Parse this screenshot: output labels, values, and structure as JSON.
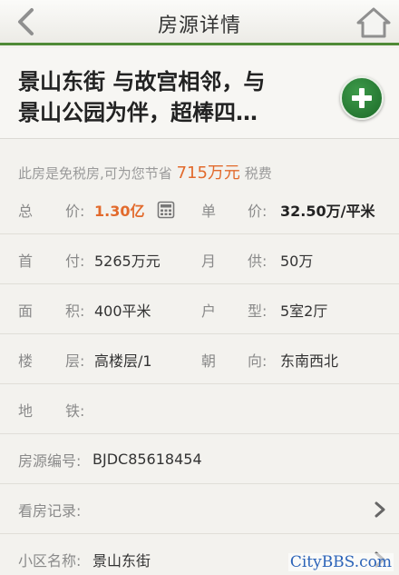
{
  "navbar": {
    "title": "房源详情"
  },
  "header": {
    "title_line1": "景山东街 与故宫相邻，与",
    "title_line2": "景山公园为伴，超棒四…"
  },
  "tax_note": {
    "prefix": "此房是免税房,可为您节省",
    "amount": "715万元",
    "suffix": "税费"
  },
  "details": {
    "total_price_label_a": "总",
    "total_price_label_b": "价:",
    "total_price": "1.30亿",
    "unit_price_label_a": "单",
    "unit_price_label_b": "价:",
    "unit_price": "32.50万/平米",
    "down_payment_label_a": "首",
    "down_payment_label_b": "付:",
    "down_payment": "5265万元",
    "monthly_label_a": "月",
    "monthly_label_b": "供:",
    "monthly": "50万",
    "area_label_a": "面",
    "area_label_b": "积:",
    "area": "400平米",
    "layout_label_a": "户",
    "layout_label_b": "型:",
    "layout": "5室2厅",
    "floor_label_a": "楼",
    "floor_label_b": "层:",
    "floor": "高楼层/1",
    "orientation_label_a": "朝",
    "orientation_label_b": "向:",
    "orientation": "东南西北",
    "subway_label_a": "地",
    "subway_label_b": "铁:",
    "listing_id_label": "房源编号:",
    "listing_id": "BJDC85618454",
    "viewing_record_label": "看房记录:",
    "community_label": "小区名称:",
    "community": "景山东街"
  },
  "watermark": "CityBBS.com",
  "colors": {
    "accent_green": "#4f8a36",
    "price_orange": "#e26a2c",
    "add_button_green": "#1c6a28"
  },
  "icons": {
    "back": "chevron-left-icon",
    "home": "house-icon",
    "add": "plus-icon",
    "calculator": "calculator-icon",
    "arrow": "chevron-right-icon"
  }
}
